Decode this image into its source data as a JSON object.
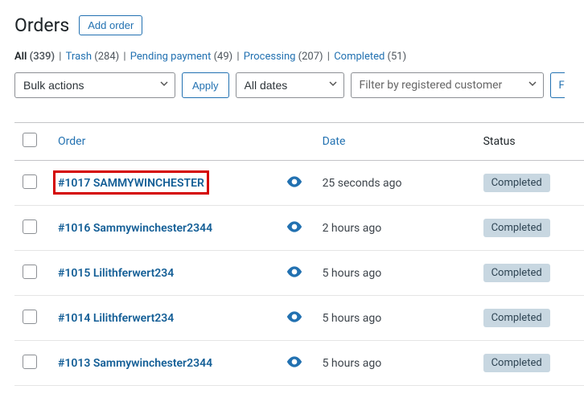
{
  "header": {
    "title": "Orders",
    "add_button": "Add order"
  },
  "filters": [
    {
      "label": "All",
      "count": "(339)",
      "current": true
    },
    {
      "label": "Trash",
      "count": "(284)"
    },
    {
      "label": "Pending payment",
      "count": "(49)"
    },
    {
      "label": "Processing",
      "count": "(207)"
    },
    {
      "label": "Completed",
      "count": "(51)"
    }
  ],
  "toolbar": {
    "bulk_actions": "Bulk actions",
    "apply": "Apply",
    "all_dates": "All dates",
    "filter_customer_placeholder": "Filter by registered customer",
    "filter_button": "Filter"
  },
  "columns": {
    "order": "Order",
    "date": "Date",
    "status": "Status"
  },
  "orders": [
    {
      "name": "#1017 SAMMYWINCHESTER",
      "date": "25 seconds ago",
      "status": "Completed",
      "highlight": true
    },
    {
      "name": "#1016 Sammywinchester2344",
      "date": "2 hours ago",
      "status": "Completed"
    },
    {
      "name": "#1015 Lilithferwert234",
      "date": "5 hours ago",
      "status": "Completed"
    },
    {
      "name": "#1014 Lilithferwert234",
      "date": "5 hours ago",
      "status": "Completed"
    },
    {
      "name": "#1013 Sammywinchester2344",
      "date": "5 hours ago",
      "status": "Completed"
    }
  ]
}
